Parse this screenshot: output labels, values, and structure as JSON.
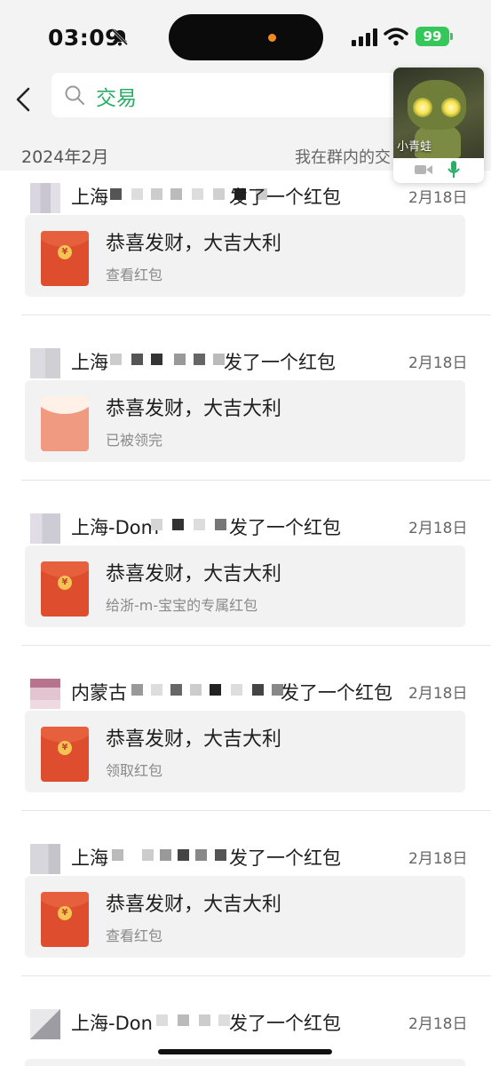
{
  "status_bar": {
    "time": "03:09",
    "battery": "99"
  },
  "search": {
    "query": "交易"
  },
  "floating_call": {
    "name": "小青蛙"
  },
  "section": {
    "date": "2024年2月",
    "filter": "我在群内的交"
  },
  "colors": {
    "accent_green": "#2aae67",
    "red_packet": "#de4e2e",
    "battery_green": "#35c759"
  },
  "records": [
    {
      "prefix": "上海",
      "suffix": "发了一个红包",
      "date": "2月18日",
      "title": "恭喜发财，大吉大利",
      "subtitle": "查看红包",
      "opened": false
    },
    {
      "prefix": "上海",
      "suffix": "发了一个红包",
      "date": "2月18日",
      "title": "恭喜发财，大吉大利",
      "subtitle": "已被领完",
      "opened": true
    },
    {
      "prefix": "上海-Dom",
      "suffix": "发了一个红包",
      "date": "2月18日",
      "title": "恭喜发财，大吉大利",
      "subtitle": "给浙-m-宝宝的专属红包",
      "opened": false
    },
    {
      "prefix": "内蒙古",
      "suffix": "发了一个红包",
      "date": "2月18日",
      "title": "恭喜发财，大吉大利",
      "subtitle": "领取红包",
      "opened": false
    },
    {
      "prefix": "上海",
      "suffix": "发了一个红包",
      "date": "2月18日",
      "title": "恭喜发财，大吉大利",
      "subtitle": "查看红包",
      "opened": false
    },
    {
      "prefix": "上海-Don",
      "suffix": "发了一个红包",
      "date": "2月18日",
      "title": "",
      "subtitle": "",
      "opened": false
    }
  ]
}
